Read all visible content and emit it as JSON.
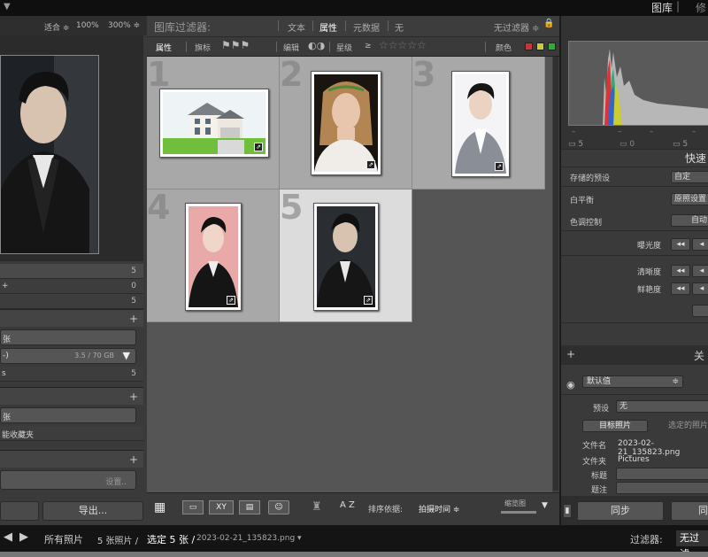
{
  "topbar": {
    "module": "图库",
    "separator": "|",
    "module2": "修"
  },
  "left": {
    "nav_zoom": [
      "适合 ≑",
      "100%",
      "300% ≑"
    ],
    "catalog": [
      {
        "label": "",
        "count": "5"
      },
      {
        "label": "+",
        "count": "0"
      },
      {
        "label": "",
        "count": "5"
      }
    ],
    "folder_field": {
      "text": "张",
      "right": ""
    },
    "drive_field": {
      "text": "-)",
      "right": "3.5 / 70 GB",
      "tri": "▼"
    },
    "folder_row": {
      "label": "s",
      "count": "5"
    },
    "collections_field": "张",
    "smart_collections": "能收藏夹",
    "settings_label": "设置..",
    "import_label": "",
    "export_label": "导出..."
  },
  "filterbar": {
    "title": "图库过滤器:",
    "tabs": [
      "文本",
      "属性",
      "元数据",
      "无"
    ],
    "preset": "无过滤器 ≑",
    "lock": "🔒"
  },
  "attrbar": {
    "attribute": "属性",
    "flag": "旗标",
    "edit": "编辑",
    "rating": "星级",
    "rating_op": "≥",
    "stars": "☆☆☆☆☆",
    "color": "颜色"
  },
  "grid": {
    "cells": [
      {
        "num": "1",
        "selected": false,
        "kind": "house"
      },
      {
        "num": "2",
        "selected": false,
        "kind": "woman"
      },
      {
        "num": "3",
        "selected": false,
        "kind": "man"
      },
      {
        "num": "4",
        "selected": false,
        "kind": "pink"
      },
      {
        "num": "5",
        "selected": true,
        "kind": "dark"
      }
    ]
  },
  "toolbar": {
    "xy": "XY",
    "sort_label": "排序依据:",
    "sort_value": "拍摄时间 ≑",
    "az": "A Z",
    "thumbs": "缩览图"
  },
  "right": {
    "histo_vals": [
      "–",
      "–",
      "–",
      "–"
    ],
    "histo_info": [
      "5",
      "0",
      "5"
    ],
    "quick": "快速",
    "saved_preset": "存储的预设",
    "saved_preset_value": "自定",
    "wb": "白平衡",
    "wb_value": "原照设置",
    "tone": "色调控制",
    "auto": "自动",
    "exposure": "曝光度",
    "clarity": "清晰度",
    "vibrance": "鲜艳度",
    "keywords": "关",
    "meta_default": "默认值",
    "preset_label": "预设",
    "preset_value": "无",
    "target": "目标照片",
    "selected": "选定的照片",
    "filename_label": "文件名",
    "filename_value": "2023-02-21_135823.png",
    "folder_label": "文件夹",
    "folder_value": "Pictures",
    "caption_label": "标题",
    "title_label": "题注",
    "sync": "同步",
    "sync2": "同"
  },
  "status": {
    "all": "所有照片",
    "count": "5 张照片 /",
    "selected": "选定 5 张 /",
    "filename": "2023-02-21_135823.png ▾",
    "filter_label": "过滤器:",
    "filter_value": "无过滤"
  },
  "colors": {
    "accent_selected_cell": "#dcdcdc",
    "cell": "#a8a8a8",
    "swatch_red": "#c33",
    "swatch_yellow": "#cc3",
    "swatch_green": "#3a3"
  }
}
